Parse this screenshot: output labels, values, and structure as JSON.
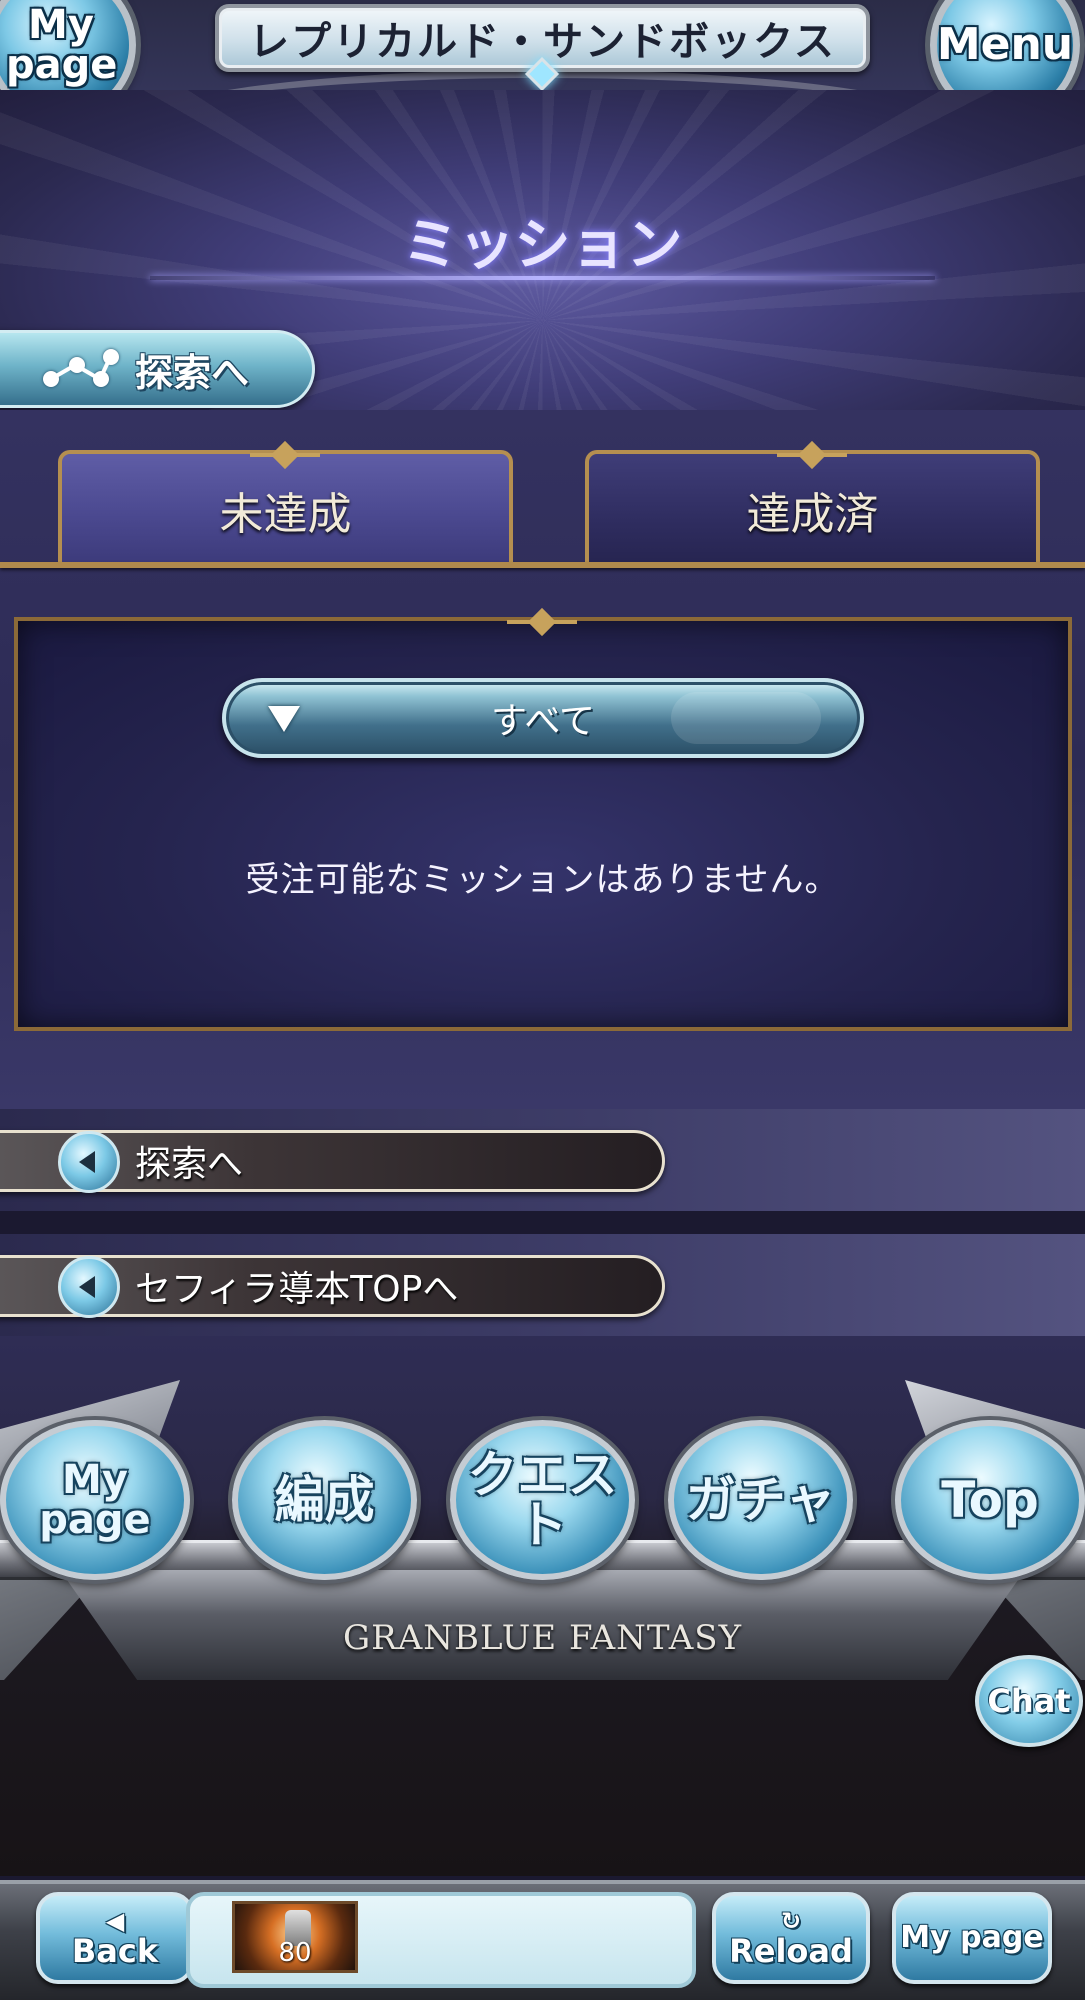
{
  "header": {
    "title": "レプリカルド・サンドボックス",
    "mypage_label": "My page",
    "menu_label": "Menu"
  },
  "banner": {
    "title": "ミッション"
  },
  "explore_button": {
    "label": "探索へ",
    "icon": "nodes-icon"
  },
  "tabs": [
    {
      "label": "未達成",
      "active": true
    },
    {
      "label": "達成済",
      "active": false
    }
  ],
  "filter": {
    "selected": "すべて",
    "icon": "triangle-down-icon"
  },
  "empty_message": "受注可能なミッションはありません。",
  "links": [
    {
      "label": "探索へ",
      "icon": "back-arrow-icon"
    },
    {
      "label": "セフィラ導本TOPへ",
      "icon": "back-arrow-icon"
    }
  ],
  "nav": {
    "mypage": "My page",
    "formation": "編成",
    "quest": "クエスト",
    "gacha": "ガチャ",
    "top": "Top",
    "logo": "GRANBLUE FANTASY",
    "chat": "Chat"
  },
  "browser_bar": {
    "back": "Back",
    "reload": "Reload",
    "mypage": "My page",
    "item_count": "80"
  },
  "colors": {
    "accent_gold": "#b58f50",
    "panel_bg": "#25244e",
    "orb_blue": "#7ec9e6"
  }
}
